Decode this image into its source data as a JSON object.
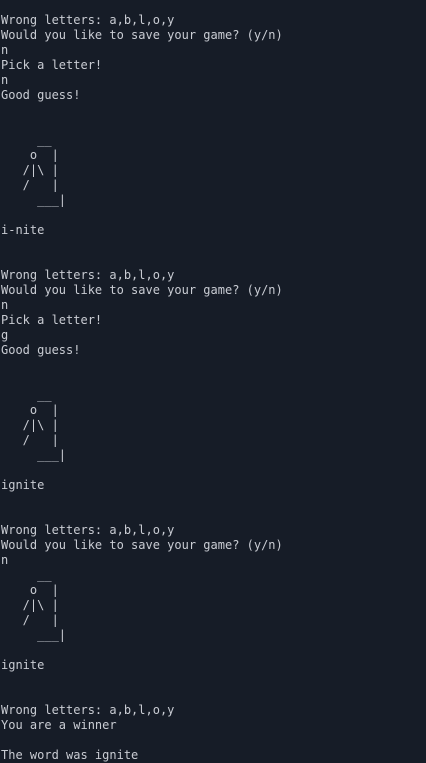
{
  "theme": {
    "background": "#161c27",
    "text": "#c9ccd3"
  },
  "terminal": {
    "lines": [
      "Wrong letters: a,b,l,o,y",
      "Would you like to save your game? (y/n)",
      "n",
      "Pick a letter!",
      "n",
      "Good guess!",
      "",
      "",
      "     __",
      "    o  |",
      "   /|\\ |",
      "   /   |",
      "     ___|",
      "",
      "i-nite",
      "",
      "",
      "Wrong letters: a,b,l,o,y",
      "Would you like to save your game? (y/n)",
      "n",
      "Pick a letter!",
      "g",
      "Good guess!",
      "",
      "",
      "     __",
      "    o  |",
      "   /|\\ |",
      "   /   |",
      "     ___|",
      "",
      "ignite",
      "",
      "",
      "Wrong letters: a,b,l,o,y",
      "Would you like to save your game? (y/n)",
      "n",
      "     __",
      "    o  |",
      "   /|\\ |",
      "   /   |",
      "     ___|",
      "",
      "ignite",
      "",
      "",
      "Wrong letters: a,b,l,o,y",
      "You are a winner",
      "",
      "The word was ignite"
    ]
  }
}
